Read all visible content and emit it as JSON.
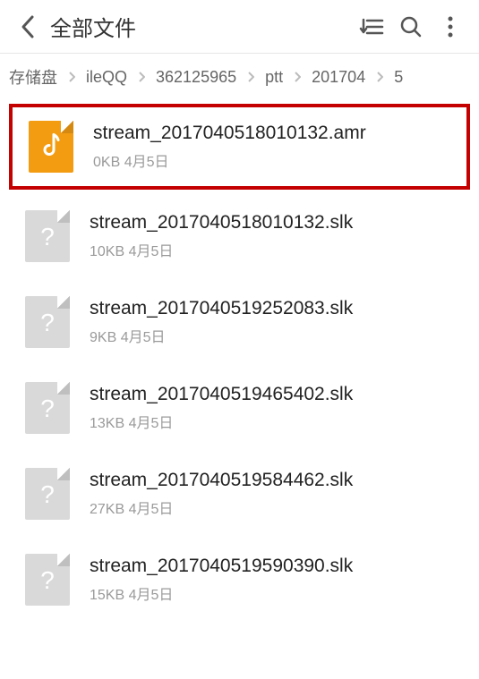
{
  "header": {
    "title": "全部文件"
  },
  "breadcrumbs": [
    "存储盘",
    "ileQQ",
    "362125965",
    "ptt",
    "201704",
    "5"
  ],
  "files": [
    {
      "name": "stream_2017040518010132.amr",
      "size": "0KB",
      "date": "4月5日",
      "type": "audio",
      "highlight": true
    },
    {
      "name": "stream_2017040518010132.slk",
      "size": "10KB",
      "date": "4月5日",
      "type": "unknown",
      "highlight": false
    },
    {
      "name": "stream_2017040519252083.slk",
      "size": "9KB",
      "date": "4月5日",
      "type": "unknown",
      "highlight": false
    },
    {
      "name": "stream_2017040519465402.slk",
      "size": "13KB",
      "date": "4月5日",
      "type": "unknown",
      "highlight": false
    },
    {
      "name": "stream_2017040519584462.slk",
      "size": "27KB",
      "date": "4月5日",
      "type": "unknown",
      "highlight": false
    },
    {
      "name": "stream_2017040519590390.slk",
      "size": "15KB",
      "date": "4月5日",
      "type": "unknown",
      "highlight": false
    }
  ]
}
